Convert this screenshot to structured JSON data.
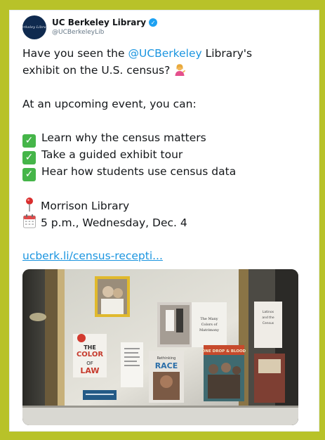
{
  "account": {
    "display_name": "UC Berkeley Library",
    "handle": "@UCBerkeleyLib",
    "avatar_text": "Berkeley Library",
    "verified_icon": "verified-badge-icon"
  },
  "tweet": {
    "line1_pre": "Have you seen the ",
    "line1_mention": "@UCBerkeley",
    "line1_post": " Library's",
    "line2": "exhibit on the U.S. census?",
    "event_intro": "At an upcoming event, you can:",
    "checklist": [
      "Learn why the census matters",
      "Take a guided exhibit tour",
      "Hear how students use census data"
    ],
    "location": "Morrison Library",
    "datetime": "5 p.m., Wednesday, Dec. 4",
    "link": "ucberk.li/census-recepti..."
  },
  "photo": {
    "book_color_title": "THE COLOR OF LAW",
    "book_race_title": "RACE",
    "book_race_pre": "Rethinking",
    "book_onedrop_title": "ONE DROP & BLOOD",
    "book_white_title": "The Many Colors of Matrimony",
    "book_right_title": "Latinos and the Census"
  },
  "colors": {
    "frame": "#b8c229",
    "mention": "#1b95e0",
    "check": "#45b549",
    "verified": "#1da1f2"
  }
}
